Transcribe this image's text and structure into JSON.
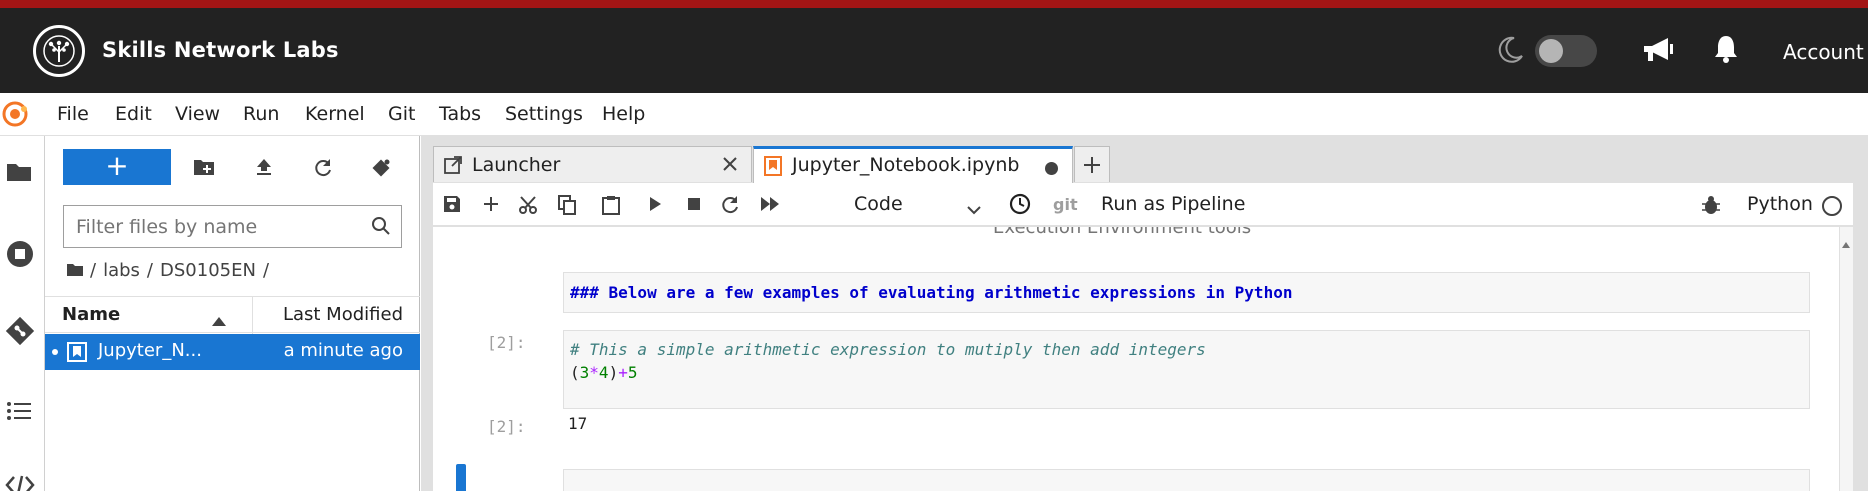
{
  "topbar": {
    "brand": "Skills Network Labs",
    "account_label": "Account",
    "icons": [
      "tree-logo-icon",
      "moon-icon",
      "theme-toggle",
      "megaphone-icon",
      "bell-icon"
    ]
  },
  "menubar": {
    "items": [
      "File",
      "Edit",
      "View",
      "Run",
      "Kernel",
      "Git",
      "Tabs",
      "Settings",
      "Help"
    ]
  },
  "left_strip": {
    "icons": [
      "folder-icon",
      "stop-circle-icon",
      "git-icon",
      "list-icon",
      "code-icon"
    ]
  },
  "filebrowser": {
    "new_label": "+",
    "filter_placeholder": "Filter files by name",
    "breadcrumb": [
      "/",
      "labs",
      "/",
      "DS0105EN",
      "/"
    ],
    "columns": {
      "name": "Name",
      "modified": "Last Modified"
    },
    "files": [
      {
        "name": "Jupyter_N...",
        "modified": "a minute ago",
        "selected": true
      }
    ]
  },
  "tabs": [
    {
      "label": "Launcher",
      "active": false
    },
    {
      "label": "Jupyter_Notebook.ipynb",
      "active": true,
      "unsaved": true
    }
  ],
  "notebook_toolbar": {
    "cell_type": "Code",
    "git_label": "git",
    "pipeline_label": "Run as Pipeline",
    "kernel_name": "Python"
  },
  "notebook": {
    "clipped_heading": "Execution Environment tools",
    "markdown_cell": "### Below are a few examples of evaluating arithmetic expressions in Python",
    "code_cell": {
      "prompt": "[2]:",
      "comment": "# This a simple arithmetic expression to mutiply then add integers",
      "code": {
        "open_paren": "(",
        "a": "3",
        "op_mul": "*",
        "b": "4",
        "close_paren": ")",
        "op_add": "+",
        "c": "5"
      }
    },
    "output": {
      "prompt": "[2]:",
      "value": "17"
    }
  },
  "colors": {
    "accent": "#1976d2",
    "topbar_bg": "#222222",
    "top_stripe": "#a31515",
    "markdown_blue": "#0000cc",
    "comment_teal": "#408080",
    "number_green": "#008000",
    "operator_purple": "#aa22ff"
  }
}
